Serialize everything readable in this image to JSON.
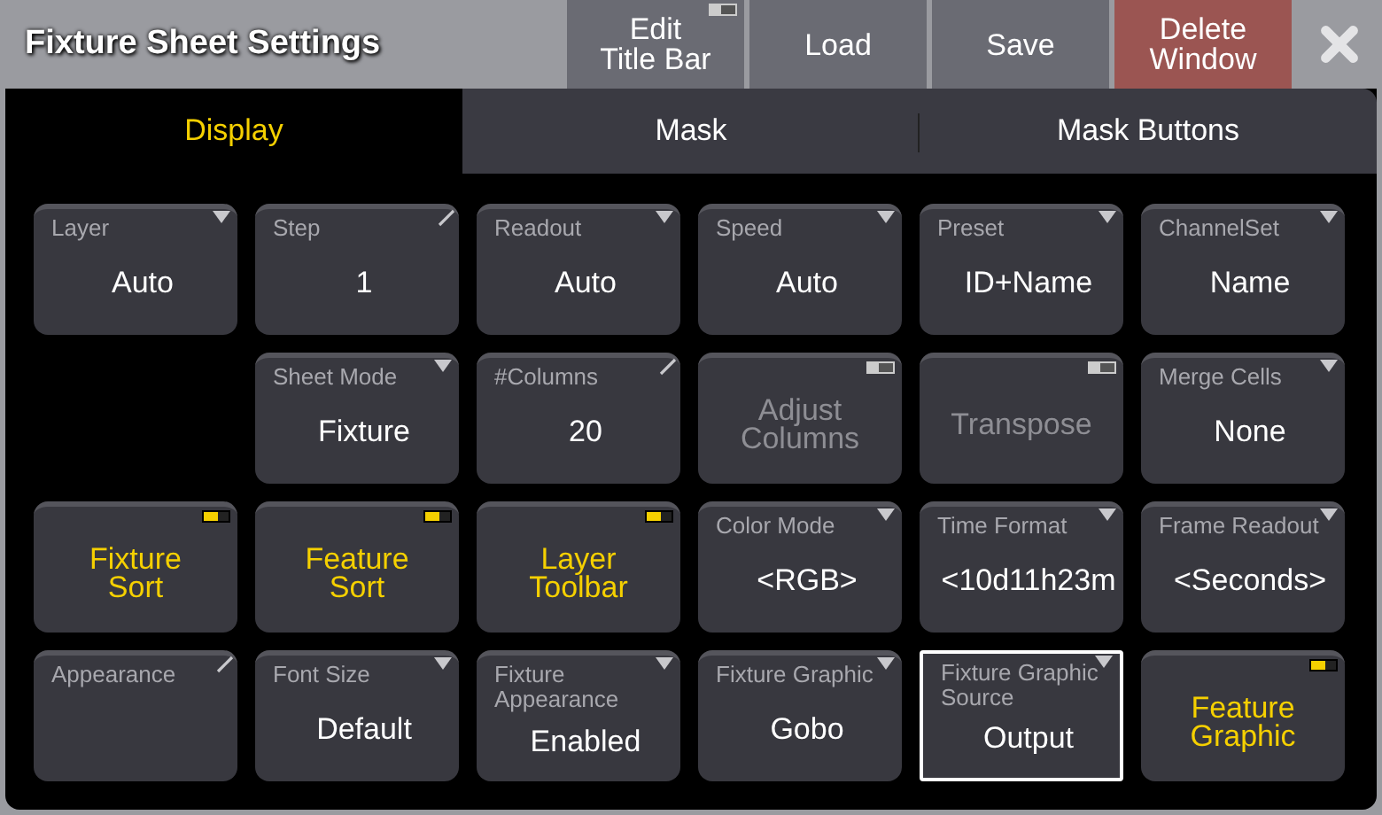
{
  "window": {
    "title": "Fixture Sheet Settings"
  },
  "title_buttons": [
    {
      "label": "Edit\nTitle Bar",
      "kind": "toggle",
      "on": false
    },
    {
      "label": "Load",
      "kind": "plain"
    },
    {
      "label": "Save",
      "kind": "plain"
    },
    {
      "label": "Delete\nWindow",
      "kind": "danger"
    }
  ],
  "tabs": [
    {
      "label": "Display",
      "selected": true
    },
    {
      "label": "Mask",
      "selected": false
    },
    {
      "label": "Mask Buttons",
      "selected": false
    }
  ],
  "rows": [
    [
      {
        "kind": "dropdown",
        "label": "Layer",
        "value": "Auto",
        "selected": false
      },
      {
        "kind": "edit",
        "label": "Step",
        "value": "1",
        "selected": false
      },
      {
        "kind": "dropdown",
        "label": "Readout",
        "value": "Auto",
        "selected": false
      },
      {
        "kind": "dropdown",
        "label": "Speed",
        "value": "Auto",
        "selected": false
      },
      {
        "kind": "dropdown",
        "label": "Preset",
        "value": "ID+Name",
        "selected": false
      },
      {
        "kind": "dropdown",
        "label": "ChannelSet",
        "value": "Name",
        "selected": false
      }
    ],
    [
      {
        "kind": "empty"
      },
      {
        "kind": "dropdown",
        "label": "Sheet Mode",
        "value": "Fixture",
        "selected": false
      },
      {
        "kind": "edit",
        "label": "#Columns",
        "value": "20",
        "selected": false
      },
      {
        "kind": "toggle",
        "label": "Adjust\nColumns",
        "on": false
      },
      {
        "kind": "toggle",
        "label": "Transpose",
        "on": false
      },
      {
        "kind": "dropdown",
        "label": "Merge Cells",
        "value": "None",
        "selected": false
      }
    ],
    [
      {
        "kind": "toggle",
        "label": "Fixture\nSort",
        "on": true
      },
      {
        "kind": "toggle",
        "label": "Feature\nSort",
        "on": true
      },
      {
        "kind": "toggle",
        "label": "Layer\nToolbar",
        "on": true
      },
      {
        "kind": "dropdown",
        "label": "Color Mode",
        "value": "<RGB>",
        "selected": false
      },
      {
        "kind": "dropdown",
        "label": "Time Format",
        "value": "<10d11h23m",
        "selected": false
      },
      {
        "kind": "dropdown",
        "label": "Frame Readout",
        "value": "<Seconds>",
        "selected": false
      }
    ],
    [
      {
        "kind": "edit",
        "label": "Appearance",
        "selected": false
      },
      {
        "kind": "dropdown",
        "label": "Font Size",
        "value": "Default",
        "selected": false
      },
      {
        "kind": "dropdown",
        "label": "Fixture\nAppearance",
        "value": "Enabled",
        "selected": false
      },
      {
        "kind": "dropdown",
        "label": "Fixture Graphic",
        "value": "Gobo",
        "selected": false
      },
      {
        "kind": "dropdown",
        "label": "Fixture Graphic\nSource",
        "value": "Output",
        "selected": true
      },
      {
        "kind": "toggle",
        "label": "Feature\nGraphic",
        "on": true
      }
    ]
  ]
}
